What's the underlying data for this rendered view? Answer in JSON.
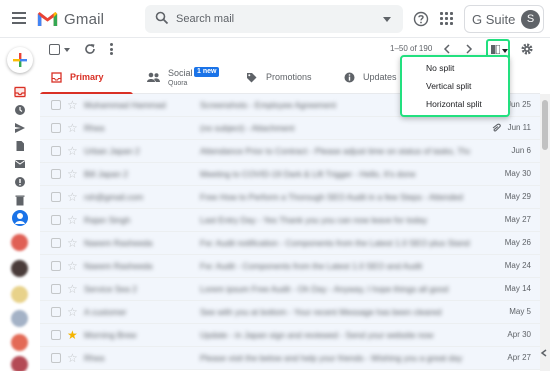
{
  "header": {
    "logo_text": "Gmail",
    "search_placeholder": "Search mail",
    "gsuite_label": "G Suite",
    "avatar_initial": "S"
  },
  "toolbar": {
    "pager": "1–50 of 190"
  },
  "tabs": [
    {
      "label": "Primary"
    },
    {
      "label": "Social",
      "badge": "1 new",
      "sub": "Quora"
    },
    {
      "label": "Promotions"
    },
    {
      "label": "Updates"
    }
  ],
  "split_menu": {
    "items": [
      "No split",
      "Vertical split",
      "Horizontal split"
    ]
  },
  "emails": [
    {
      "sender": "Muhammad Hammad",
      "subject": "Screenshots - Employee Agreement",
      "date": "Jun 25",
      "starred": false,
      "attachment": false
    },
    {
      "sender": "Rhea",
      "subject": "(no subject) - Attachment",
      "date": "Jun 11",
      "starred": false,
      "attachment": true
    },
    {
      "sender": "Urban Japan 2",
      "subject": "Attendance Prior to Contract - Please adjust time on status of tasks, Thank",
      "date": "Jun 6",
      "starred": false,
      "attachment": false
    },
    {
      "sender": "Bill Japan 2",
      "subject": "Meeting to COVID-19 Dark & Lift Trigger - Hello, It's done",
      "date": "May 30",
      "starred": false,
      "attachment": false
    },
    {
      "sender": "rsh@gmail.com",
      "subject": "Free How to Perform a Thorough SEO Audit in a few Steps - Attended",
      "date": "May 29",
      "starred": false,
      "attachment": false
    },
    {
      "sender": "Rajan Singh",
      "subject": "Last Entry Day - Yes Thank you you can now leave for today",
      "date": "May 27",
      "starred": false,
      "attachment": false
    },
    {
      "sender": "Naeem Rasheeda",
      "subject": "Fw: Audit notification - Components from the Latest 1.0 SEO plus Standard",
      "date": "May 26",
      "starred": false,
      "attachment": false
    },
    {
      "sender": "Naeem Rasheeda",
      "subject": "Fw: Audit - Components from the Latest 1.0 SEO and Audit",
      "date": "May 24",
      "starred": false,
      "attachment": false
    },
    {
      "sender": "Service Sea 2",
      "subject": "Lorem ipsum Free Audit - Oh Day - Anyway, I hope things all good",
      "date": "May 14",
      "starred": false,
      "attachment": false
    },
    {
      "sender": "A customer",
      "subject": "See with you at bottom - Your recent Message has been cleared",
      "date": "May 5",
      "starred": false,
      "attachment": false
    },
    {
      "sender": "Morning Brew",
      "subject": "Update - in Japan sign and reviewed - Send your website now",
      "date": "Apr 30",
      "starred": true,
      "attachment": false
    },
    {
      "sender": "Rhea",
      "subject": "Please visit the below and help your friends - Wishing you a great day",
      "date": "Apr 27",
      "starred": false,
      "attachment": false
    }
  ],
  "colors": {
    "accent_red": "#d93025",
    "highlight_green": "#22e07f",
    "badge_blue": "#1a73e8",
    "star_yellow": "#f4b400"
  }
}
